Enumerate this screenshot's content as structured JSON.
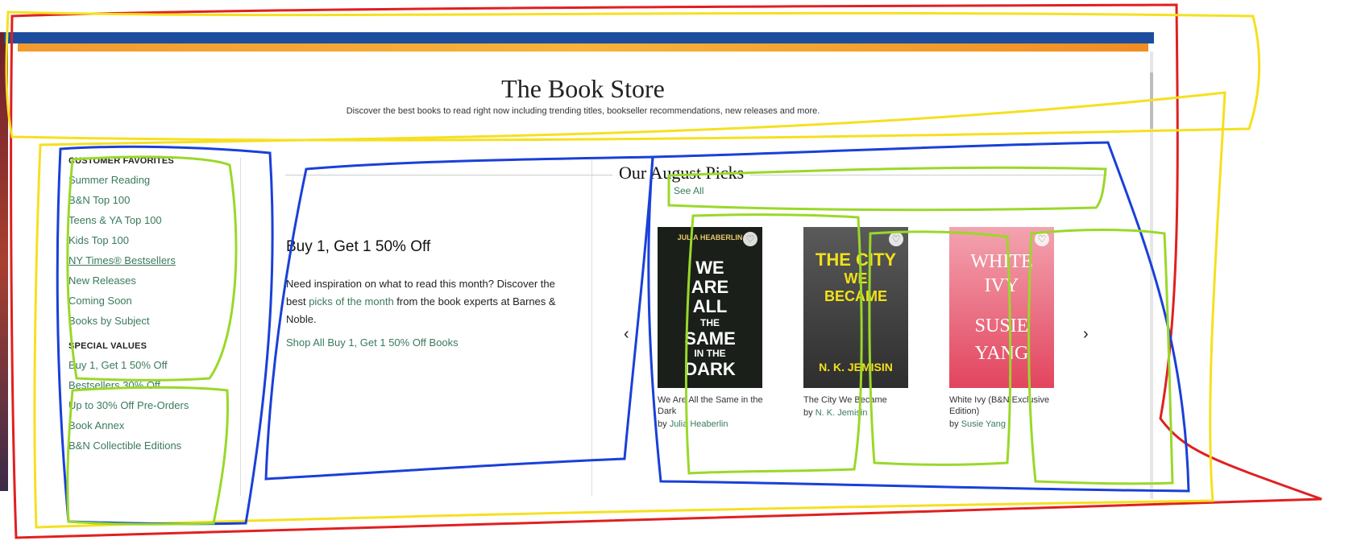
{
  "header": {
    "title": "The Book Store",
    "description": "Discover the best books to read right now including trending titles, bookseller recommendations, new releases and more."
  },
  "sidebar": {
    "group1": {
      "heading": "CUSTOMER FAVORITES",
      "items": [
        "Summer Reading",
        "B&N Top 100",
        "Teens & YA Top 100",
        "Kids Top 100",
        "NY Times® Bestsellers",
        "New Releases",
        "Coming Soon",
        "Books by Subject"
      ]
    },
    "group2": {
      "heading": "SPECIAL VALUES",
      "items": [
        "Buy 1, Get 1 50% Off",
        "Bestsellers 30% Off",
        "Up to 30% Off Pre-Orders",
        "Book Annex",
        "B&N Collectible Editions"
      ]
    }
  },
  "promo": {
    "title": "Buy 1, Get 1 50% Off",
    "text_before": "Need inspiration on what to read this month? Discover the best ",
    "text_link": "picks of the month",
    "text_after": " from the book experts at Barnes & Noble.",
    "shop_link": "Shop All Buy 1, Get 1 50% Off Books"
  },
  "picks": {
    "title": "Our August Picks",
    "see_all": "See All",
    "prev_arrow": "‹",
    "next_arrow": "›",
    "by_label": "by",
    "books": [
      {
        "title": "We Are All the Same in the Dark",
        "author": "Julia Heaberlin",
        "cover_lines": [
          "JULIA HEABERLIN",
          "WE",
          "ARE",
          "ALL",
          "THE",
          "SAME",
          "IN THE",
          "DARK"
        ],
        "cover_bg": "#1a1f1a",
        "cover_fg": "#ffffff"
      },
      {
        "title": "The City We Became",
        "author": "N. K. Jemisin",
        "cover_lines": [
          "THE CITY",
          "WE",
          "BECAME",
          "N. K. JEMISIN"
        ],
        "cover_bg": "#3a3a3a",
        "cover_fg": "#f2e11a"
      },
      {
        "title": "White Ivy (B&N Exclusive Edition)",
        "author": "Susie Yang",
        "cover_lines": [
          "WHITE",
          "IVY",
          "SUSIE",
          "YANG"
        ],
        "cover_bg": "#e8526a",
        "cover_fg": "#ffffff"
      }
    ]
  },
  "colors": {
    "link_green": "#3a7a5c",
    "topbar_blue": "#1d4d9e",
    "annotation_red": "#e02020",
    "annotation_yellow": "#f5e020",
    "annotation_blue": "#1a40d8",
    "annotation_green": "#9ad82a"
  }
}
